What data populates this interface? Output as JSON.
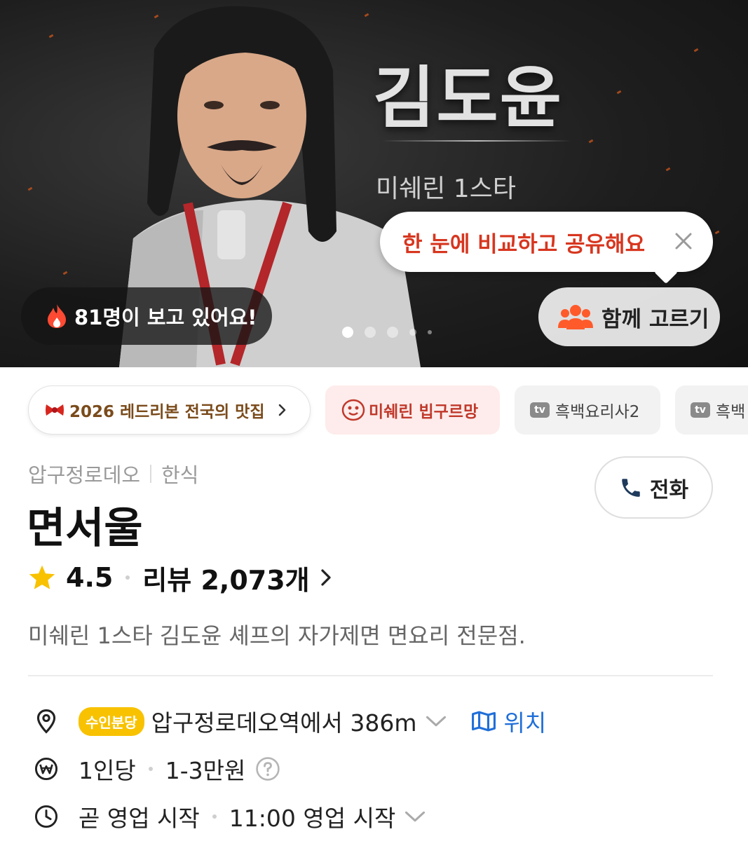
{
  "hero": {
    "name": "김도윤",
    "subtitle": "미쉐린 1스타",
    "tooltip": "한 눈에 비교하고 공유해요",
    "viewers": "81명이 보고 있어요!",
    "together_label": "함께 고르기",
    "slide_count": 5,
    "slide_active": 1
  },
  "chips": [
    {
      "label": "2026 레드리본 전국의 맛집",
      "icon": "red-ribbon-icon"
    },
    {
      "label": "미쉐린 빕구르망",
      "icon": "michelin-bib-icon"
    },
    {
      "label": "흑백요리사2",
      "icon": "tv-icon",
      "badge": "tv"
    },
    {
      "label": "흑백",
      "icon": "tv-icon",
      "badge": "tv"
    }
  ],
  "place": {
    "area": "압구정로데오",
    "cuisine": "한식",
    "name": "면서울",
    "rating": "4.5",
    "reviews": "리뷰 2,073개",
    "description": "미쉐린 1스타 김도윤 셰프의 자가제면 면요리 전문점.",
    "call_label": "전화"
  },
  "details": {
    "exit_badge": "수인분당",
    "distance": "압구정로데오역에서 386m",
    "location_label": "위치",
    "price_label": "1인당",
    "price": "1-3만원",
    "hours_status": "곧 영업 시작",
    "hours_time": "11:00 영업 시작"
  },
  "colors": {
    "accent_red": "#d7361f",
    "star": "#f8c200",
    "link_blue": "#1f6fd9",
    "badge_yellow": "#f8c200"
  }
}
